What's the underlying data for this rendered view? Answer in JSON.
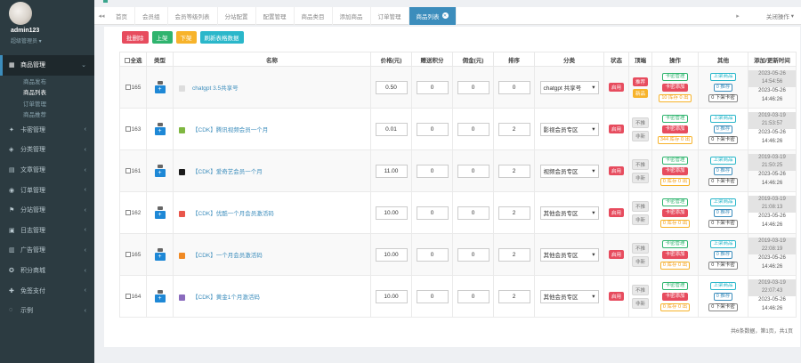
{
  "sidebar": {
    "user_name": "admin123",
    "user_role": "超级管理员",
    "menu": [
      {
        "label": "商品管理",
        "active": true
      },
      {
        "label": "卡密管理"
      },
      {
        "label": "分类管理"
      },
      {
        "label": "文章管理"
      },
      {
        "label": "订单管理"
      },
      {
        "label": "分站管理"
      },
      {
        "label": "日志管理"
      },
      {
        "label": "广告管理"
      },
      {
        "label": "积分商城"
      },
      {
        "label": "免签支付"
      },
      {
        "label": "示例"
      }
    ],
    "submenu": [
      {
        "label": "商品发布"
      },
      {
        "label": "商品列表",
        "active": true
      },
      {
        "label": "订单管理"
      },
      {
        "label": "商品推荐"
      }
    ]
  },
  "topbar": {
    "tabs": [
      {
        "label": "首页"
      },
      {
        "label": "会员组"
      },
      {
        "label": "会员等级列表"
      },
      {
        "label": "分站配置"
      },
      {
        "label": "配置管理"
      },
      {
        "label": "商品类目"
      },
      {
        "label": "添加商品"
      },
      {
        "label": "订单管理"
      },
      {
        "label": "商品列表",
        "active": true
      }
    ],
    "close_ops": "关闭操作"
  },
  "toolbar": {
    "delete": "批删除",
    "up": "上架",
    "down": "下架",
    "refresh": "刷新表格数据"
  },
  "table": {
    "headers": [
      "全选",
      "类型",
      "名称",
      "价格(元)",
      "赠送积分",
      "佣金(元)",
      "排序",
      "分类",
      "状态",
      "顶端",
      "操作",
      "其他",
      "添加/更新时间"
    ],
    "rows": [
      {
        "id": "165",
        "name": "chatgpt 3.5共享号",
        "price": "0.50",
        "points": "0",
        "commission": "0",
        "sort": "0",
        "category": "chatgpt 共享号",
        "status": "启用",
        "top1": "推荐",
        "top2": "新品",
        "op1": "卡密管理",
        "op2": "卡密添加",
        "op3": "10 库存 0 出",
        "other1": "上架商品",
        "other2": "0 推荐",
        "other3": "0 下架卡密",
        "time1": "2023-05-26 14:54:56",
        "time2": "2023-05-26 14:46:26",
        "thumb": "#dddddd"
      },
      {
        "id": "163",
        "name": "【CDK】腾讯视频会员一个月",
        "price": "0.01",
        "points": "0",
        "commission": "0",
        "sort": "2",
        "category": "影视会员专区",
        "status": "启用",
        "top1": "不推",
        "top2": "非新",
        "op1": "卡密管理",
        "op2": "卡密添加",
        "op3": "344 库存 0 出",
        "other1": "上架商品",
        "other2": "0 推荐",
        "other3": "0 下架卡密",
        "time1": "2019-03-19 21:53:57",
        "time2": "2023-05-26 14:46:26",
        "thumb": "#7fb741"
      },
      {
        "id": "161",
        "name": "【CDK】爱奇艺会员一个月",
        "price": "11.00",
        "points": "0",
        "commission": "0",
        "sort": "2",
        "category": "视频会员专区",
        "status": "启用",
        "top1": "不推",
        "top2": "非新",
        "op1": "卡密管理",
        "op2": "卡密添加",
        "op3": "0 库存 0 出",
        "other1": "上架商品",
        "other2": "0 推荐",
        "other3": "0 下架卡密",
        "time1": "2019-03-19 21:50:25",
        "time2": "2023-05-26 14:46:26",
        "thumb": "#1b1b1b"
      },
      {
        "id": "162",
        "name": "【CDK】优酷一个月会员激活码",
        "price": "10.00",
        "points": "0",
        "commission": "0",
        "sort": "2",
        "category": "其他会员专区",
        "status": "启用",
        "top1": "不推",
        "top2": "非新",
        "op1": "卡密管理",
        "op2": "卡密添加",
        "op3": "0 库存 0 出",
        "other1": "上架商品",
        "other2": "0 推荐",
        "other3": "0 下架卡密",
        "time1": "2019-03-19 21:08:13",
        "time2": "2023-05-26 14:46:26",
        "thumb": "#e9564b"
      },
      {
        "id": "165",
        "name": "【CDK】一个月会员激活码",
        "price": "10.00",
        "points": "0",
        "commission": "0",
        "sort": "2",
        "category": "其他会员专区",
        "status": "启用",
        "top1": "不推",
        "top2": "非新",
        "op1": "卡密管理",
        "op2": "卡密添加",
        "op3": "0 库存 0 出",
        "other1": "上架商品",
        "other2": "0 推荐",
        "other3": "0 下架卡密",
        "time1": "2019-03-19 22:08:19",
        "time2": "2023-05-26 14:46:26",
        "thumb": "#f08a24"
      },
      {
        "id": "164",
        "name": "【CDK】黄金1个月激活码",
        "price": "10.00",
        "points": "0",
        "commission": "0",
        "sort": "2",
        "category": "其他会员专区",
        "status": "启用",
        "top1": "不推",
        "top2": "非新",
        "op1": "卡密管理",
        "op2": "卡密添加",
        "op3": "0 库存 0 出",
        "other1": "上架商品",
        "other2": "0 推荐",
        "other3": "0 下架卡密",
        "time1": "2019-03-19 22:07:43",
        "time2": "2023-05-26 14:46:26",
        "thumb": "#8a6bbd"
      }
    ]
  },
  "footer": {
    "summary": "共6条数据，第1页，共1页"
  }
}
